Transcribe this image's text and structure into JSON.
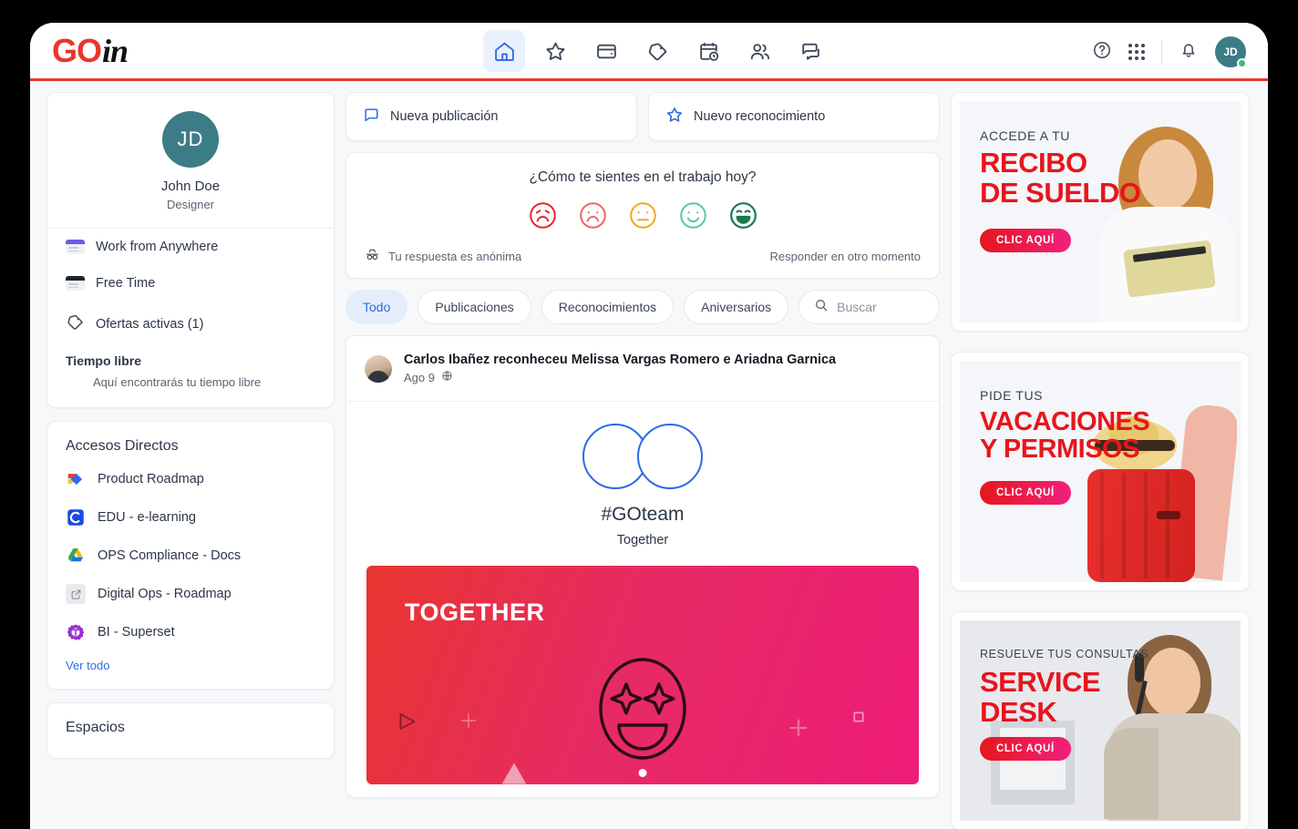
{
  "brand": {
    "logo_go": "GO",
    "logo_in": "in"
  },
  "topnav": {
    "items": [
      {
        "name": "home-icon",
        "label": "Inicio",
        "active": true
      },
      {
        "name": "star-icon",
        "label": "Reconocimientos",
        "active": false
      },
      {
        "name": "wallet-icon",
        "label": "Beneficios",
        "active": false
      },
      {
        "name": "tag-icon",
        "label": "Ofertas",
        "active": false
      },
      {
        "name": "calendar-clock-icon",
        "label": "Calendario",
        "active": false
      },
      {
        "name": "people-icon",
        "label": "Personas",
        "active": false
      },
      {
        "name": "chat-icon",
        "label": "Mensajes",
        "active": false
      }
    ],
    "help_icon": "help-circle-icon",
    "apps_icon": "apps-grid-icon",
    "bell_icon": "bell-icon",
    "avatar_initials": "JD"
  },
  "sidebar": {
    "profile": {
      "initials": "JD",
      "name": "John Doe",
      "role": "Designer"
    },
    "items": [
      {
        "label": "Work from Anywhere",
        "icon": "card-purple-icon"
      },
      {
        "label": "Free Time",
        "icon": "card-black-icon"
      },
      {
        "label": "Ofertas activas (1)",
        "icon": "tag-icon"
      }
    ],
    "tiempo_libre": {
      "title": "Tiempo libre",
      "subtitle": "Aquí encontrarás tu tiempo libre"
    },
    "shortcuts": {
      "title": "Accesos Directos",
      "items": [
        {
          "label": "Product Roadmap",
          "icon": "productboard-icon"
        },
        {
          "label": "EDU - e-learning",
          "icon": "canvas-icon"
        },
        {
          "label": "OPS Compliance - Docs",
          "icon": "google-drive-icon"
        },
        {
          "label": "Digital Ops - Roadmap",
          "icon": "external-link-icon"
        },
        {
          "label": "BI - Superset",
          "icon": "superset-icon"
        }
      ],
      "see_all": "Ver todo"
    },
    "spaces_title": "Espacios"
  },
  "feed": {
    "actions": [
      {
        "label": "Nueva publicación",
        "icon": "chat-bubble-icon"
      },
      {
        "label": "Nuevo reconocimiento",
        "icon": "star-icon"
      }
    ],
    "mood": {
      "question": "¿Cómo te sientes en el trabajo hoy?",
      "faces": [
        {
          "name": "face-very-sad",
          "color": "#E8262F"
        },
        {
          "name": "face-sad",
          "color": "#F0636B"
        },
        {
          "name": "face-neutral",
          "color": "#F5A623"
        },
        {
          "name": "face-happy",
          "color": "#5CC89A"
        },
        {
          "name": "face-very-happy",
          "color": "#1B7A4A"
        }
      ],
      "anonymous_note": "Tu respuesta es anónima",
      "later_label": "Responder en otro momento"
    },
    "filters": [
      {
        "label": "Todo",
        "active": true
      },
      {
        "label": "Publicaciones",
        "active": false
      },
      {
        "label": "Reconocimientos",
        "active": false
      },
      {
        "label": "Aniversarios",
        "active": false
      }
    ],
    "search": {
      "value": "",
      "placeholder": "Buscar"
    },
    "post": {
      "title": "Carlos Ibañez reconheceu Melissa Vargas Romero e Ariadna Garnica",
      "date": "Ago 9",
      "visibility_icon": "globe-icon",
      "hashtag": "#GOteam",
      "subtitle": "Together",
      "banner_word": "TOGETHER"
    }
  },
  "promos": [
    {
      "kicker": "ACCEDE A TU",
      "title_line1": "RECIBO",
      "title_line2": "DE SUELDO",
      "button": "CLIC AQUÍ",
      "accent": "#E8151C"
    },
    {
      "kicker": "PIDE TUS",
      "title_line1": "VACACIONES",
      "title_line2": "Y PERMISOS",
      "button": "CLIC AQUÍ",
      "accent": "#E8151C"
    },
    {
      "kicker": "RESUELVE TUS CONSULTAS",
      "title_line1": "SERVICE",
      "title_line2": "DESK",
      "button": "CLIC AQUÍ",
      "accent": "#E8151C"
    }
  ]
}
